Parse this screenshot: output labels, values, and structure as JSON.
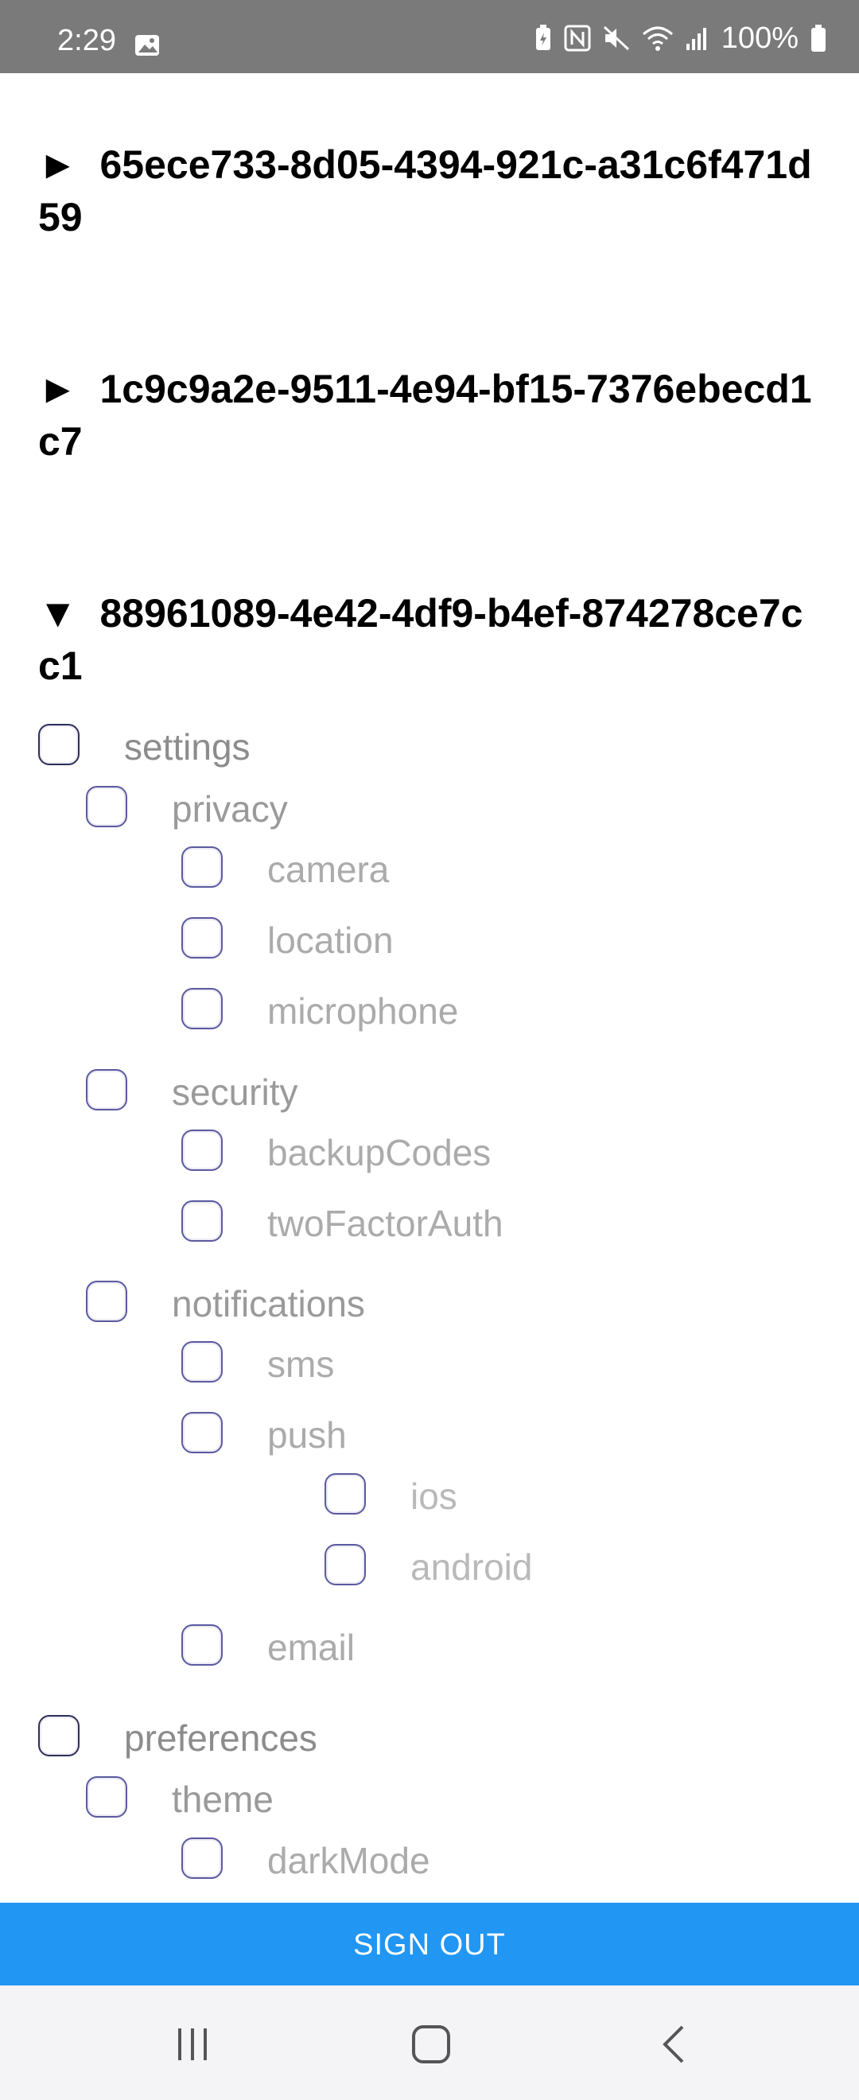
{
  "status_bar": {
    "time": "2:29",
    "battery": "100%",
    "icons": [
      "gallery-icon",
      "battery-saver-icon",
      "nfc-icon",
      "mute-icon",
      "wifi-icon",
      "signal-icon",
      "battery-icon"
    ]
  },
  "groups": [
    {
      "arrow": "►",
      "title": "65ece733-8d05-4394-921c-a31c6f471d59",
      "expanded": false
    },
    {
      "arrow": "►",
      "title": "1c9c9a2e-9511-4e94-bf15-7376ebecd1c7",
      "expanded": false
    },
    {
      "arrow": "▼",
      "title": "88961089-4e42-4df9-b4ef-874278ce7cc1",
      "expanded": true
    }
  ],
  "tree": {
    "settings": "settings",
    "privacy": "privacy",
    "camera": "camera",
    "location": "location",
    "microphone": "microphone",
    "security": "security",
    "backupCodes": "backupCodes",
    "twoFactorAuth": "twoFactorAuth",
    "notifications": "notifications",
    "sms": "sms",
    "push": "push",
    "ios": "ios",
    "android": "android",
    "email": "email",
    "preferences": "preferences",
    "theme": "theme",
    "darkMode": "darkMode"
  },
  "actions": {
    "sign_out": "SIGN OUT"
  },
  "colors": {
    "accent": "#2196f3",
    "status_bar": "#7a7a7a",
    "checkbox_border": "#5a5aa0"
  },
  "nav": {
    "icons": [
      "recent-apps-icon",
      "home-icon",
      "back-icon"
    ]
  }
}
